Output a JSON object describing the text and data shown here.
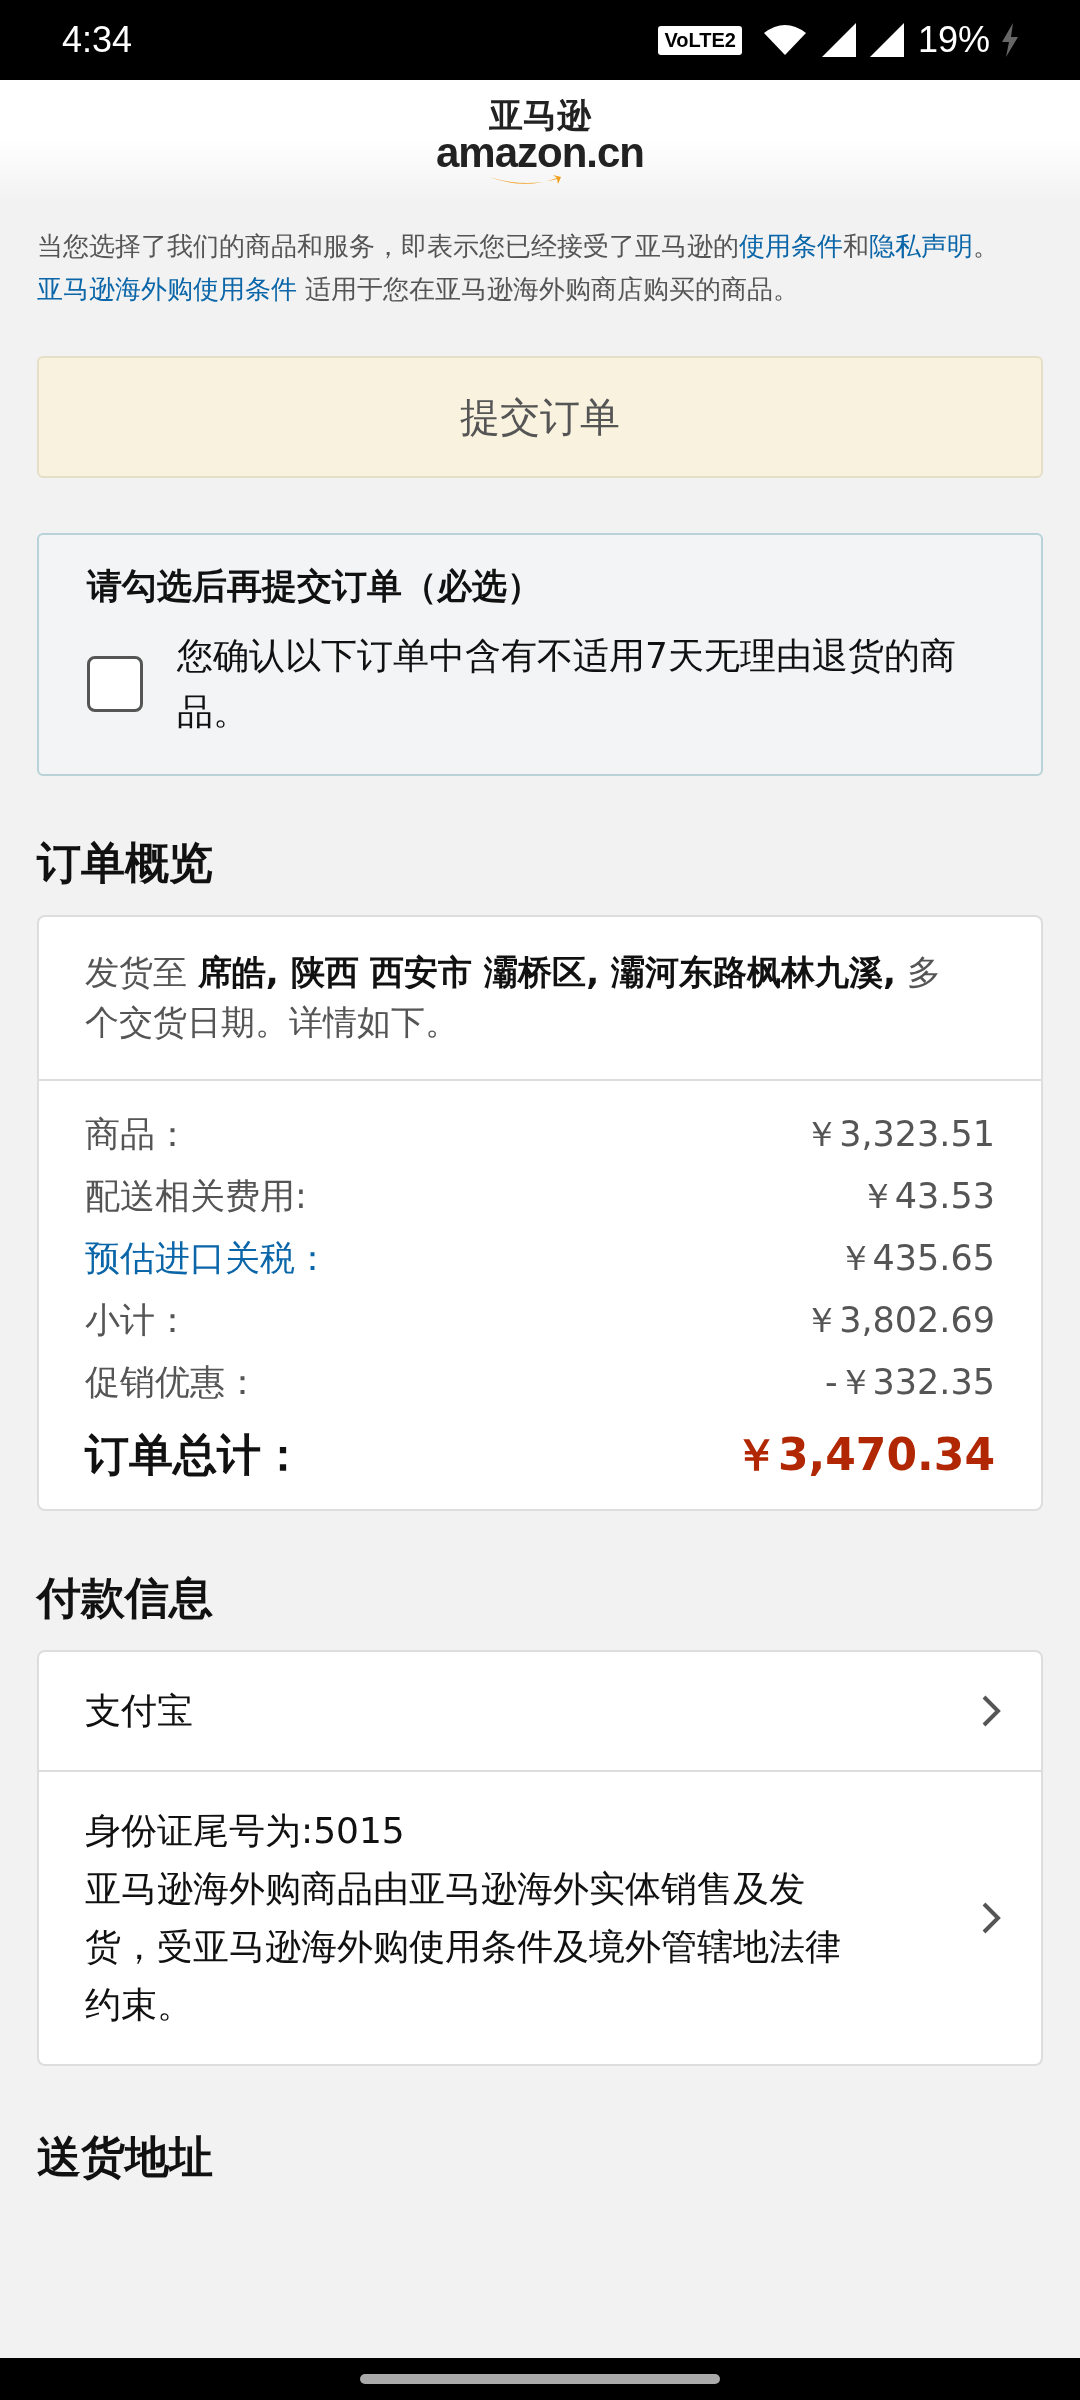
{
  "status_bar": {
    "time": "4:34",
    "network_badge": "VoLTE2",
    "battery": "19%"
  },
  "header": {
    "logo_cn": "亚马逊",
    "logo_en": "amazon.cn"
  },
  "terms": [
    {
      "kind": "text",
      "text": "当您选择了我们的商品和服务，即表示您已经接受了亚马逊的"
    },
    {
      "kind": "link",
      "text": "使用条件"
    },
    {
      "kind": "text",
      "text": "和"
    },
    {
      "kind": "link",
      "text": "隐私声明"
    },
    {
      "kind": "text",
      "text": "。"
    },
    {
      "kind": "link",
      "text": "亚马逊海外购使用条件"
    },
    {
      "kind": "text",
      "text": " 适用于您在亚马逊海外购商店购买的商品。"
    }
  ],
  "submit_button": {
    "label": "提交订单"
  },
  "confirmation": {
    "title": "请勾选后再提交订单（必选）",
    "checked": false,
    "label": "您确认以下订单中含有不适用7天无理由退货的商品。"
  },
  "order_summary": {
    "heading": "订单概览",
    "ship_to": "发货至 **席皓, 陕西 西安市 灞桥区, 灞河东路枫林九溪,** 多个交货日期。详情如下。",
    "lines": [
      {
        "kind": "text",
        "label": "商品：",
        "value": "￥3,323.51"
      },
      {
        "kind": "text",
        "label": "配送相关费用:",
        "value": "￥43.53"
      },
      {
        "kind": "link",
        "label": "预估进口关税：",
        "value": "￥435.65"
      },
      {
        "kind": "text",
        "label": "小计：",
        "value": "￥3,802.69"
      },
      {
        "kind": "text",
        "label": "促销优惠：",
        "value": "-￥332.35"
      }
    ],
    "total": {
      "label": "订单总计：",
      "value": "￥3,470.34"
    }
  },
  "payment": {
    "heading": "付款信息",
    "rows": [
      {
        "lines": [
          "支付宝"
        ]
      },
      {
        "lines": [
          "身份证尾号为:5015",
          "亚马逊海外购商品由亚马逊海外实体销售及发货，受亚马逊海外购使用条件及境外管辖地法律约束。"
        ]
      }
    ]
  },
  "next_section": {
    "heading": "送货地址"
  }
}
